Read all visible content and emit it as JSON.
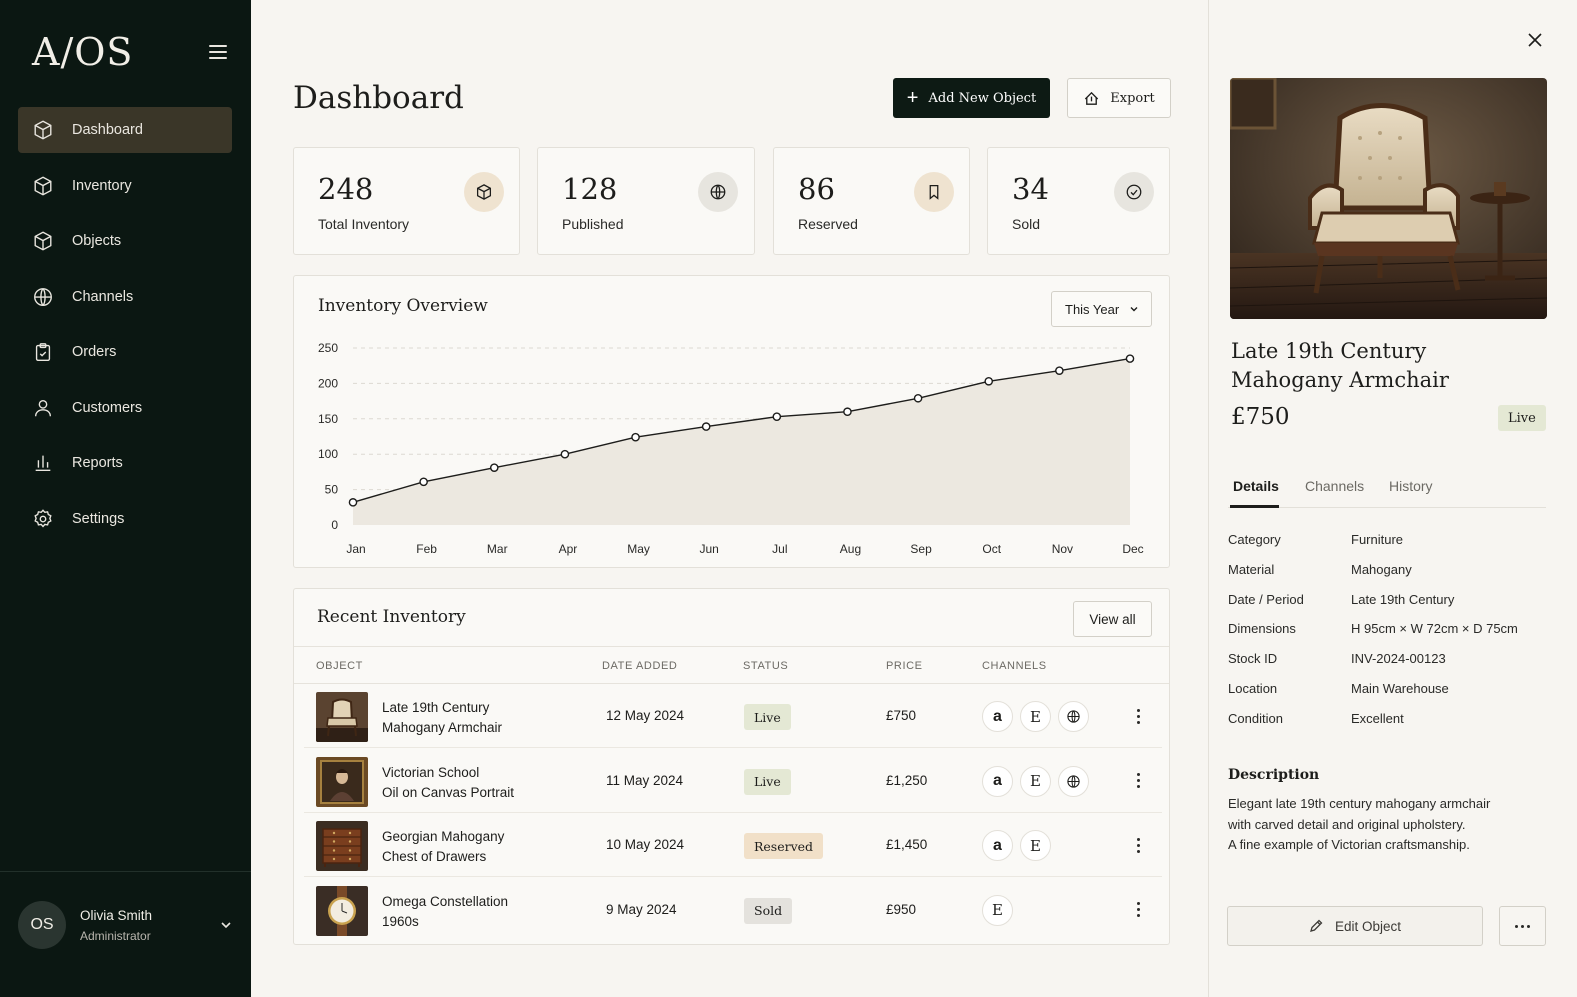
{
  "app": {
    "logo": "A/OS"
  },
  "sidebar": {
    "items": [
      {
        "label": "Dashboard",
        "icon": "cube-icon",
        "active": true
      },
      {
        "label": "Inventory",
        "icon": "cube-icon"
      },
      {
        "label": "Objects",
        "icon": "cube-icon"
      },
      {
        "label": "Channels",
        "icon": "globe-icon"
      },
      {
        "label": "Orders",
        "icon": "clipboard-icon"
      },
      {
        "label": "Customers",
        "icon": "user-icon"
      },
      {
        "label": "Reports",
        "icon": "bar-chart-icon"
      },
      {
        "label": "Settings",
        "icon": "gear-icon"
      }
    ],
    "user": {
      "initials": "OS",
      "name": "Olivia Smith",
      "role": "Administrator"
    }
  },
  "header": {
    "title": "Dashboard",
    "add_label": "Add New Object",
    "export_label": "Export"
  },
  "stats": [
    {
      "value": "248",
      "label": "Total Inventory",
      "icon": "cube-icon",
      "color": "#efe3d0"
    },
    {
      "value": "128",
      "label": "Published",
      "icon": "globe-icon",
      "color": "#e7e5df"
    },
    {
      "value": "86",
      "label": "Reserved",
      "icon": "bookmark-icon",
      "color": "#efe3d0"
    },
    {
      "value": "34",
      "label": "Sold",
      "icon": "check-circle-icon",
      "color": "#e7e5df"
    }
  ],
  "overview": {
    "title": "Inventory Overview",
    "period": "This Year",
    "chart_data": {
      "type": "area",
      "categories": [
        "Jan",
        "Feb",
        "Mar",
        "Apr",
        "May",
        "Jun",
        "Jul",
        "Aug",
        "Sep",
        "Oct",
        "Nov",
        "Dec"
      ],
      "values": [
        32,
        61,
        81,
        100,
        124,
        139,
        153,
        160,
        179,
        203,
        218,
        235
      ],
      "ylim": [
        0,
        250
      ],
      "yticks": [
        0,
        50,
        100,
        150,
        200,
        250
      ],
      "grid": true
    }
  },
  "recent": {
    "title": "Recent Inventory",
    "view_all": "View all",
    "columns": [
      "OBJECT",
      "DATE ADDED",
      "STATUS",
      "PRICE",
      "CHANNELS"
    ],
    "rows": [
      {
        "name1": "Late 19th Century",
        "name2": "Mahogany Armchair",
        "date": "12 May 2024",
        "status": "Live",
        "price": "£750",
        "channels": [
          "a",
          "E",
          "globe"
        ],
        "thumb": "armchair"
      },
      {
        "name1": "Victorian School",
        "name2": "Oil on Canvas Portrait",
        "date": "11 May 2024",
        "status": "Live",
        "price": "£1,250",
        "channels": [
          "a",
          "E",
          "globe"
        ],
        "thumb": "portrait"
      },
      {
        "name1": "Georgian Mahogany",
        "name2": "Chest of Drawers",
        "date": "10 May 2024",
        "status": "Reserved",
        "price": "£1,450",
        "channels": [
          "a",
          "E"
        ],
        "thumb": "drawers"
      },
      {
        "name1": "Omega Constellation",
        "name2": "1960s",
        "date": "9 May 2024",
        "status": "Sold",
        "price": "£950",
        "channels": [
          "E"
        ],
        "thumb": "watch"
      }
    ],
    "status_colors": {
      "Live": "#e4e8d4",
      "Reserved": "#f1e0c8",
      "Sold": "#e4e2dd"
    }
  },
  "detail": {
    "title_line1": "Late 19th Century",
    "title_line2": "Mahogany Armchair",
    "price": "£750",
    "status": "Live",
    "tabs": [
      "Details",
      "Channels",
      "History"
    ],
    "fields": [
      {
        "k": "Category",
        "v": "Furniture"
      },
      {
        "k": "Material",
        "v": "Mahogany"
      },
      {
        "k": "Date / Period",
        "v": "Late 19th Century"
      },
      {
        "k": "Dimensions",
        "v": "H 95cm × W 72cm × D 75cm"
      },
      {
        "k": "Stock ID",
        "v": "INV-2024-00123"
      },
      {
        "k": "Location",
        "v": "Main Warehouse"
      },
      {
        "k": "Condition",
        "v": "Excellent"
      }
    ],
    "description_title": "Description",
    "description_lines": [
      "Elegant late 19th century mahogany armchair",
      "with carved detail and original upholstery.",
      "A fine example of Victorian craftsmanship."
    ],
    "edit_label": "Edit Object"
  }
}
